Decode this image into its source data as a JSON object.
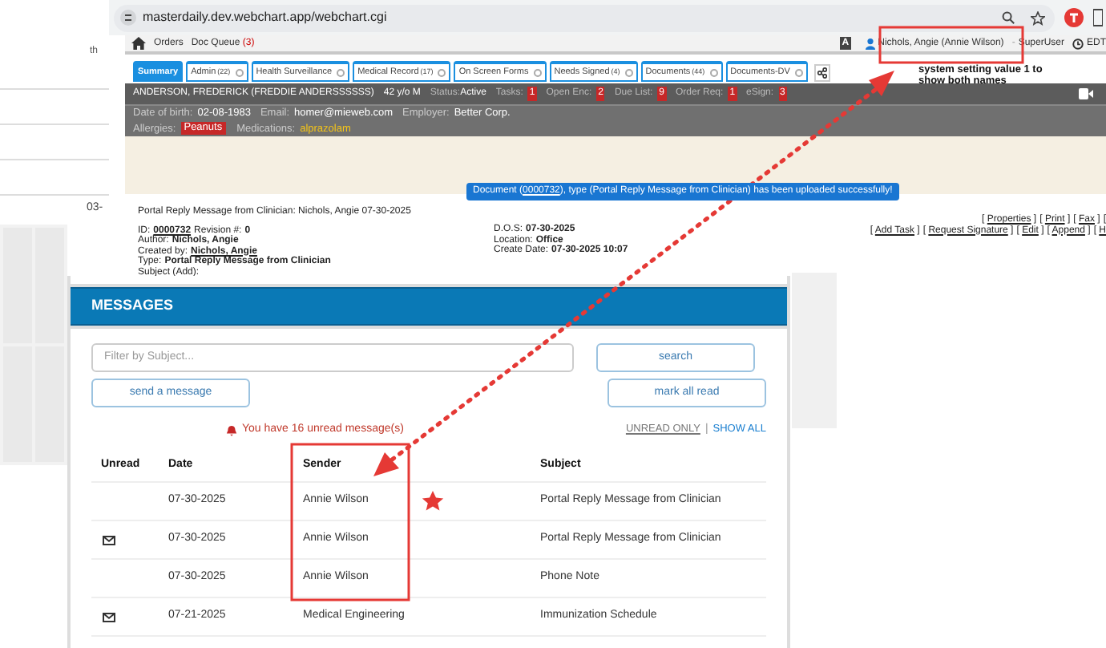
{
  "browser": {
    "url": "masterdaily.dev.webchart.app/webchart.cgi"
  },
  "nav": [
    {
      "label": "Orders"
    },
    {
      "label": "Doc Queue",
      "count": "(3)"
    }
  ],
  "user": {
    "badge": "A",
    "name": "Nichols, Angie (Annie Wilson)",
    "separator": "-",
    "role": "SuperUser",
    "timezone": "EDT"
  },
  "tabs": [
    {
      "label": "Summary",
      "selected": true
    },
    {
      "label": "Admin",
      "count": "(22)",
      "selected": false
    },
    {
      "label": "Health Surveillance",
      "selected": false
    },
    {
      "label": "Medical Record",
      "count": "(17)",
      "selected": false
    },
    {
      "label": "On Screen Forms",
      "selected": false
    },
    {
      "label": "Needs Signed",
      "count": "(4)",
      "selected": false
    },
    {
      "label": "Documents",
      "count": "(44)",
      "selected": false
    },
    {
      "label": "Documents-DV",
      "selected": false
    }
  ],
  "patient": {
    "name": "ANDERSON, FREDERICK (FREDDIE ANDERSSSSSS)",
    "age": "42 y/o M",
    "status_label": "Status:",
    "status": "Active",
    "counters": [
      {
        "label": "Tasks:",
        "value": "1"
      },
      {
        "label": "Open Enc:",
        "value": "2"
      },
      {
        "label": "Due List:",
        "value": "9"
      },
      {
        "label": "Order Req:",
        "value": "1"
      },
      {
        "label": "eSign:",
        "value": "3"
      }
    ],
    "details": [
      {
        "label": "Date of birth:",
        "value": "02-08-1983"
      },
      {
        "label": "Email:",
        "value": "homer@mieweb.com"
      },
      {
        "label": "Employer:",
        "value": "Better Corp."
      }
    ],
    "allergies_label": "Allergies:",
    "allergies": "Peanuts",
    "medications_label": "Medications:",
    "medications": "alprazolam"
  },
  "notice": {
    "before": "Document (",
    "link": "0000732",
    "after": "), type (Portal Reply Message from Clinician) has been uploaded successfully!"
  },
  "document": {
    "title": "Portal Reply Message from Clinician: Nichols, Angie 07-30-2025",
    "left": [
      {
        "label": "ID:",
        "value": "0000732",
        "kind": "link",
        "extra_label": "Revision #:",
        "extra_value": "0"
      },
      {
        "label": "Author:",
        "value": "Nichols, Angie",
        "kind": "bold"
      },
      {
        "label": "Created by:",
        "value": "Nichols, Angie",
        "kind": "link"
      },
      {
        "label": "Type:",
        "value": "Portal Reply Message from Clinician",
        "kind": "bold"
      },
      {
        "label": "Subject (",
        "value": "Add",
        "kind": "inline_link",
        "after": "):"
      }
    ],
    "right": [
      {
        "label": "D.O.S:",
        "value": "07-30-2025"
      },
      {
        "label": "Location:",
        "value": "Office"
      },
      {
        "label": "Create Date:",
        "value": "07-30-2025 10:07"
      }
    ],
    "bracket_open": "[",
    "bracket_close": "]",
    "action_rows": [
      [
        {
          "label": "Properties",
          "cut": false
        },
        {
          "label": "Print",
          "cut": false
        },
        {
          "label": "Fax",
          "cut": false
        },
        {
          "cut": true
        }
      ],
      [
        {
          "label": "Add Task",
          "cut": false
        },
        {
          "label": "Request Signature",
          "cut": false
        },
        {
          "label": "Edit",
          "cut": false
        },
        {
          "label": "Append",
          "cut": false
        },
        {
          "label": "H",
          "cut": true
        }
      ]
    ]
  },
  "background": {
    "column_1": "th",
    "column_2": "03-"
  },
  "messages": {
    "title": "MESSAGES",
    "filter": {
      "placeholder": "Filter by Subject..."
    },
    "search_button": "search",
    "send_button": "send a message",
    "mark_read_button": "mark all read",
    "unread_notice": "You have 16 unread message(s)",
    "view_separator": "|",
    "view_filters": [
      {
        "label": "UNREAD ONLY",
        "selected": true
      },
      {
        "label": "SHOW ALL",
        "selected": false
      }
    ],
    "columns": [
      "Unread",
      "Date",
      "Sender",
      "Subject"
    ],
    "rows": [
      {
        "unread": false,
        "date": "07-30-2025",
        "sender": "Annie Wilson",
        "subject": "Portal Reply Message from Clinician"
      },
      {
        "unread": true,
        "date": "07-30-2025",
        "sender": "Annie Wilson",
        "subject": "Portal Reply Message from Clinician"
      },
      {
        "unread": false,
        "date": "07-30-2025",
        "sender": "Annie Wilson",
        "subject": "Phone Note"
      },
      {
        "unread": true,
        "date": "07-21-2025",
        "sender": "Medical Engineering",
        "subject": "Immunization Schedule"
      }
    ]
  },
  "annotation": {
    "note": "system setting value 1 to show both names"
  }
}
